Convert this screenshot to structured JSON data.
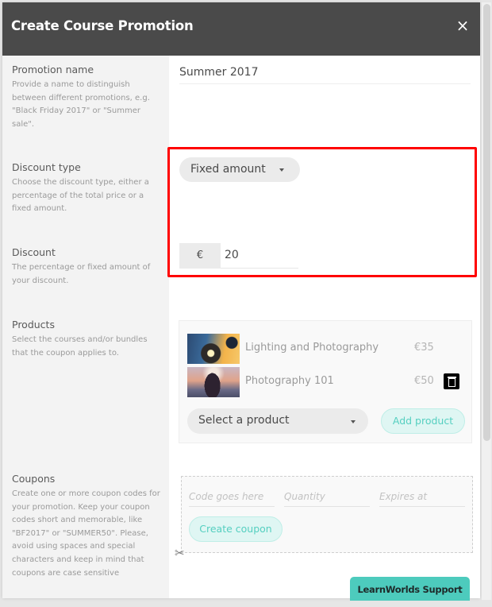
{
  "modal": {
    "title": "Create Course Promotion",
    "close_icon": "×"
  },
  "sections": {
    "promotion_name": {
      "heading": "Promotion name",
      "description": "Provide a name to distinguish between different promotions, e.g. \"Black Friday 2017\" or \"Summer sale\".",
      "value": "Summer 2017"
    },
    "discount_type": {
      "heading": "Discount type",
      "description": "Choose the discount type, either a percentage of the total price or a fixed amount.",
      "selected": "Fixed amount"
    },
    "discount": {
      "heading": "Discount",
      "description": "The percentage or fixed amount of your discount.",
      "currency_symbol": "€",
      "value": "20"
    },
    "products": {
      "heading": "Products",
      "description": "Select the courses and/or bundles that the coupon applies to.",
      "items": [
        {
          "name": "Lighting and Photography",
          "price": "€35"
        },
        {
          "name": "Photography 101",
          "price": "€50"
        }
      ],
      "select_placeholder": "Select a product",
      "add_button": "Add product"
    },
    "coupons": {
      "heading": "Coupons",
      "description": "Create one or more coupon codes for your promotion. Keep your coupon codes short and memorable, like \"BF2017\" or \"SUMMER50\". Please, avoid using spaces and special characters and keep in mind that coupons are case sensitive",
      "code_placeholder": "Code goes here",
      "quantity_placeholder": "Quantity",
      "expires_placeholder": "Expires at",
      "create_button": "Create coupon"
    }
  },
  "support_button": "LearnWorlds Support",
  "icons": {
    "scissors": "✂"
  },
  "colors": {
    "header_bg": "#4a4a4a",
    "accent_teal": "#4dcbbd",
    "highlight_red": "#ff0000"
  }
}
